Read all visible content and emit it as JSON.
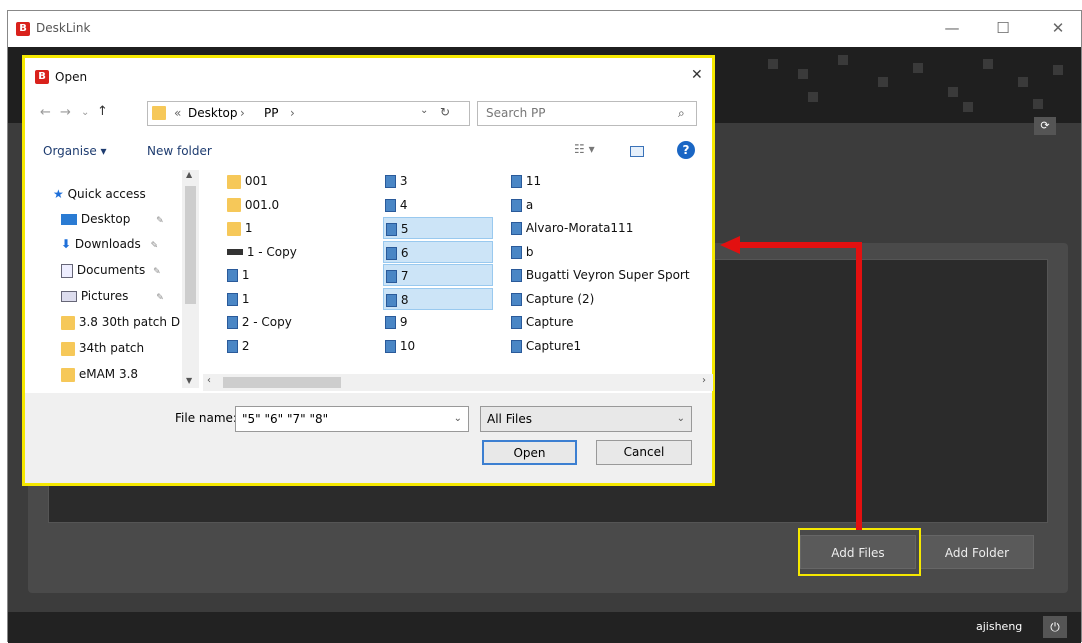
{
  "app": {
    "title": "DeskLink",
    "icon": "desklink-app-icon",
    "window_controls": [
      "—",
      "☐",
      "✕"
    ]
  },
  "main": {
    "refresh_icon": "refresh-icon",
    "buttons": {
      "add_files": "Add Files",
      "add_folder": "Add Folder"
    },
    "status": {
      "user": "ajisheng",
      "power_icon": "power-icon"
    }
  },
  "dialog": {
    "title": "Open",
    "close": "✕",
    "breadcrumb": {
      "prefix": "«",
      "items": [
        "Desktop",
        "PP"
      ],
      "sep": "›"
    },
    "search_placeholder": "Search PP",
    "toolbar": {
      "organise": "Organise ▾",
      "new_folder": "New folder"
    },
    "nav_pane": [
      {
        "label": "Quick access",
        "icon": "star-icon"
      },
      {
        "label": "Desktop",
        "icon": "desktop-icon",
        "pin": "📌"
      },
      {
        "label": "Downloads",
        "icon": "download-icon",
        "pin": "📌"
      },
      {
        "label": "Documents",
        "icon": "documents-icon",
        "pin": "📌"
      },
      {
        "label": "Pictures",
        "icon": "pictures-icon",
        "pin": "📌"
      },
      {
        "label": "3.8 30th patch D",
        "icon": "folder-icon"
      },
      {
        "label": "34th patch",
        "icon": "folder-icon"
      },
      {
        "label": "eMAM 3.8",
        "icon": "folder-icon"
      }
    ],
    "files_col1": [
      {
        "name": "001",
        "type": "folder"
      },
      {
        "name": "001.0",
        "type": "folder"
      },
      {
        "name": "1",
        "type": "folder"
      },
      {
        "name": "1 - Copy",
        "type": "dark"
      },
      {
        "name": "1",
        "type": "file"
      },
      {
        "name": "1",
        "type": "file"
      },
      {
        "name": "2 - Copy",
        "type": "file"
      },
      {
        "name": "2",
        "type": "file"
      }
    ],
    "files_col2": [
      {
        "name": "3",
        "type": "file",
        "selected": false
      },
      {
        "name": "4",
        "type": "file",
        "selected": false
      },
      {
        "name": "5",
        "type": "file",
        "selected": true
      },
      {
        "name": "6",
        "type": "file",
        "selected": true
      },
      {
        "name": "7",
        "type": "file",
        "selected": true
      },
      {
        "name": "8",
        "type": "file",
        "selected": true
      },
      {
        "name": "9",
        "type": "file",
        "selected": false
      },
      {
        "name": "10",
        "type": "file",
        "selected": false
      }
    ],
    "files_col3": [
      {
        "name": "11",
        "type": "file"
      },
      {
        "name": "a",
        "type": "file"
      },
      {
        "name": "Alvaro-Morata111",
        "type": "file"
      },
      {
        "name": "b",
        "type": "file"
      },
      {
        "name": "Bugatti Veyron Super Sport",
        "type": "file"
      },
      {
        "name": "Capture (2)",
        "type": "file"
      },
      {
        "name": "Capture",
        "type": "file"
      },
      {
        "name": "Capture1",
        "type": "file"
      }
    ],
    "file_name_label": "File name:",
    "file_name_value": "\"5\" \"6\" \"7\" \"8\"",
    "file_type": "All Files",
    "open_button": "Open",
    "cancel_button": "Cancel"
  },
  "colors": {
    "highlight_box": "#f5e800",
    "arrow": "#e21010",
    "selection": "#cce4f7"
  }
}
